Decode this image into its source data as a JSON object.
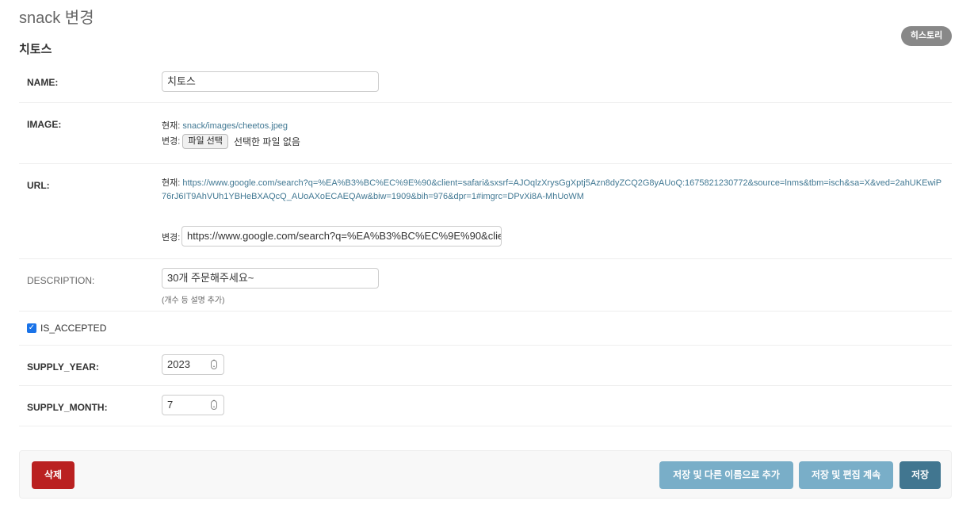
{
  "page": {
    "title": "snack 변경",
    "object_title": "치토스",
    "history_label": "히스토리"
  },
  "fields": {
    "name": {
      "label": "NAME:",
      "value": "치토스"
    },
    "image": {
      "label": "IMAGE:",
      "current_prefix": "현재:",
      "current_value": "snack/images/cheetos.jpeg",
      "change_prefix": "변경:",
      "file_button": "파일 선택",
      "file_status": "선택한 파일 없음"
    },
    "url": {
      "label": "URL:",
      "current_prefix": "현재:",
      "current_value": "https://www.google.com/search?q=%EA%B3%BC%EC%9E%90&client=safari&sxsrf=AJOqlzXrysGgXptj5Azn8dyZCQ2G8yAUoQ:1675821230772&source=lnms&tbm=isch&sa=X&ved=2ahUKEwiP76rJ6IT9AhVUh1YBHeBXAQcQ_AUoAXoECAEQAw&biw=1909&bih=976&dpr=1#imgrc=DPvXi8A-MhUoWM",
      "change_prefix": "변경:",
      "input_value": "https://www.google.com/search?q=%EA%B3%BC%EC%9E%90&clier"
    },
    "description": {
      "label": "DESCRIPTION:",
      "value": "30개 주문해주세요~",
      "help": "(개수 등 설명 추가)"
    },
    "is_accepted": {
      "label": "IS_ACCEPTED",
      "checked": true
    },
    "supply_year": {
      "label": "SUPPLY_YEAR:",
      "value": "2023"
    },
    "supply_month": {
      "label": "SUPPLY_MONTH:",
      "value": "7"
    }
  },
  "actions": {
    "delete": "삭제",
    "save_add_another": "저장 및 다른 이름으로 추가",
    "save_continue": "저장 및 편집 계속",
    "save": "저장"
  },
  "colors": {
    "delete": "#ba2121",
    "secondary": "#79aec8",
    "primary": "#417690",
    "link": "#417893"
  }
}
